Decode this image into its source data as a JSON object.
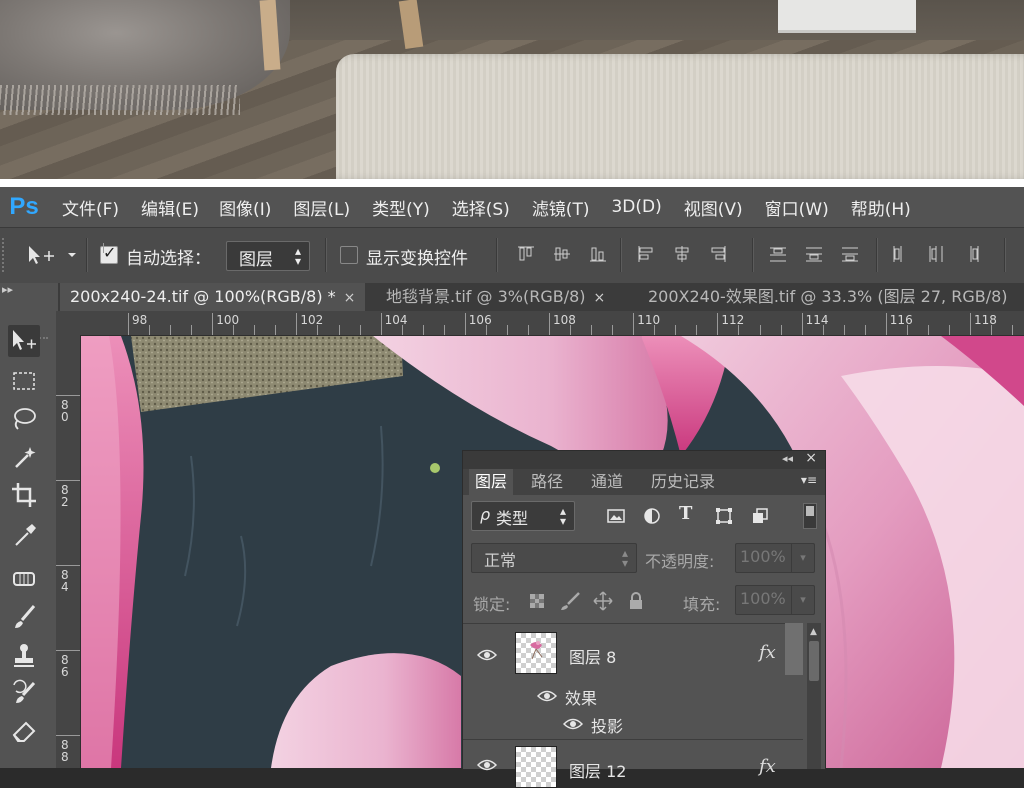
{
  "app": {
    "logo": "Ps"
  },
  "menu": [
    "文件(F)",
    "编辑(E)",
    "图像(I)",
    "图层(L)",
    "类型(Y)",
    "选择(S)",
    "滤镜(T)",
    "3D(D)",
    "视图(V)",
    "窗口(W)",
    "帮助(H)"
  ],
  "options": {
    "auto_select_label": "自动选择：",
    "auto_select_checked": true,
    "auto_select_target": "图层",
    "show_transform_label": "显示变换控件",
    "show_transform_checked": false
  },
  "tabs": [
    {
      "label": "200x240-24.tif @ 100%(RGB/8) *",
      "close": "×",
      "active": true
    },
    {
      "label": "地毯背景.tif @ 3%(RGB/8)",
      "close": "×",
      "active": false
    },
    {
      "label": "200X240-效果图.tif @ 33.3% (图层 27, RGB/8)",
      "close": "",
      "active": false
    }
  ],
  "ruler": {
    "h_labels": [
      "98",
      "100",
      "102",
      "104",
      "106",
      "108",
      "110",
      "112",
      "114",
      "116",
      "118"
    ],
    "v_labels": [
      [
        "8",
        "0"
      ],
      [
        "8",
        "2"
      ],
      [
        "8",
        "4"
      ],
      [
        "8",
        "6"
      ],
      [
        "8",
        "8"
      ]
    ]
  },
  "tools": [
    "move-tool-icon",
    "marquee-tool-icon",
    "lasso-tool-icon",
    "magic-wand-tool-icon",
    "crop-tool-icon",
    "eyedropper-tool-icon",
    "healing-brush-tool-icon",
    "brush-tool-icon",
    "clone-stamp-tool-icon",
    "history-brush-tool-icon",
    "eraser-tool-icon"
  ],
  "layers_panel": {
    "collapse": "◂◂",
    "close": "×",
    "tabs": [
      "图层",
      "路径",
      "通道",
      "历史记录"
    ],
    "menu_icon": "▾≡",
    "filter_kind": "类型",
    "filter_prefix": "ρ",
    "filter_icons": [
      "image-filter-icon",
      "adjustment-filter-icon",
      "type-filter-icon",
      "shape-filter-icon",
      "smart-object-filter-icon"
    ],
    "blend_mode": "正常",
    "opacity_label": "不透明度:",
    "opacity_value": "100%",
    "lock_label": "锁定:",
    "fill_label": "填充:",
    "fill_value": "100%",
    "layers": [
      {
        "name": "图层 8",
        "fx": "fx",
        "visible": true
      },
      {
        "name": "效果",
        "visible": true,
        "kind": "effects"
      },
      {
        "name": "投影",
        "visible": true,
        "kind": "effect-item"
      },
      {
        "name": "图层 12",
        "fx": "fx",
        "visible": true
      }
    ]
  },
  "colors": {
    "accent": "#31a8ff",
    "menu_bg": "#535353",
    "panel_bg": "#535353"
  }
}
